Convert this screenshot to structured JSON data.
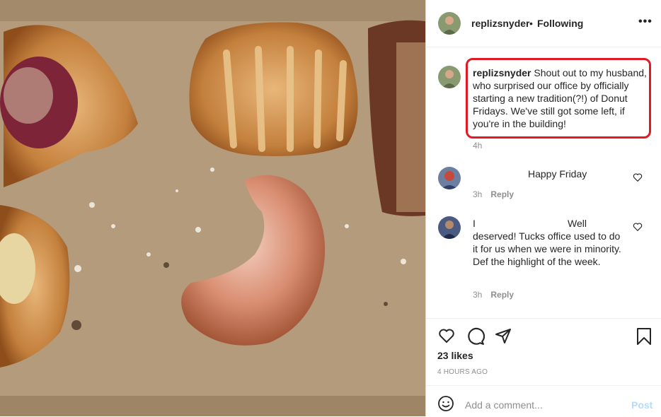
{
  "post": {
    "username": "replizsnyder",
    "separator": "•",
    "follow_status": "Following",
    "more_icon": "•••",
    "caption": {
      "username": "replizsnyder",
      "text": "Shout out to my husband, who surprised our office by officially starting a new tradition(?!) of Donut Fridays. We've still got some left, if you're in the building!",
      "time": "4h"
    },
    "comments": [
      {
        "text": "Happy Friday",
        "time": "3h",
        "reply_label": "Reply"
      },
      {
        "prefix": "I",
        "text_first": "Well",
        "text_rest": "deserved! Tucks office used to do it for us when we were in minority. Def the highlight of the week.",
        "time": "3h",
        "reply_label": "Reply"
      }
    ],
    "likes": "23 likes",
    "timestamp": "4 HOURS AGO",
    "add_comment_placeholder": "Add a comment...",
    "post_button": "Post",
    "colors": {
      "highlight": "#e11a26",
      "post_button": "#b3dbff"
    }
  }
}
